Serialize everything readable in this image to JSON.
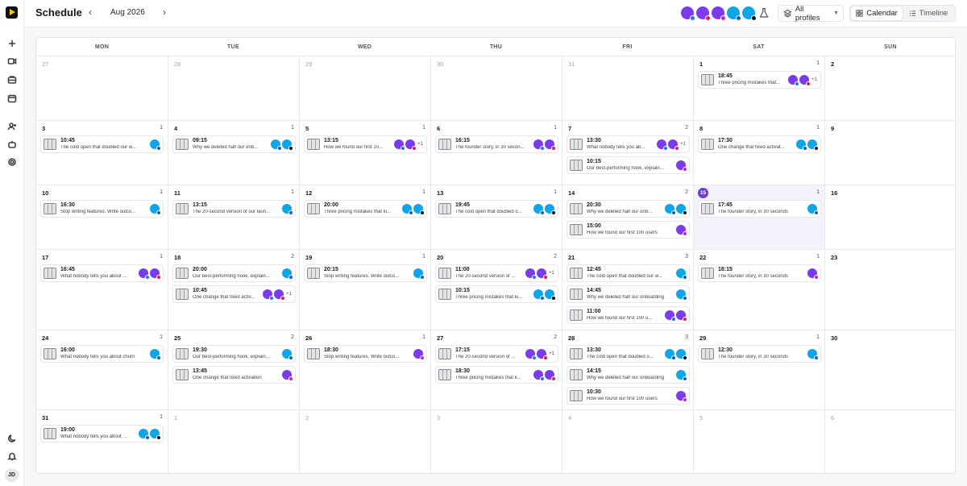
{
  "app": {
    "title": "Schedule",
    "month": "Aug 2026",
    "prev_icon": "‹",
    "next_icon": "›",
    "user_initials": "JD"
  },
  "toolbar": {
    "profiles_label": "All profiles",
    "calendar_label": "Calendar",
    "timeline_label": "Timeline"
  },
  "weekdays": [
    "MON",
    "TUE",
    "WED",
    "THU",
    "FRI",
    "SAT",
    "SUN"
  ],
  "colors": {
    "accent": "#6d3fd1",
    "purple": "#7c3aed",
    "teal": "#0ea5e9"
  },
  "rail_icons": [
    "plus-icon",
    "video-icon",
    "inbox-icon",
    "calendar-icon",
    "add-user-icon",
    "bot-icon",
    "settings-icon",
    "moon-icon",
    "bell-icon"
  ],
  "profile_avatars": [
    {
      "color": "p",
      "badge": "fb"
    },
    {
      "color": "p",
      "badge": "yt"
    },
    {
      "color": "p",
      "badge": "ig"
    },
    {
      "color": "t",
      "badge": "li"
    },
    {
      "color": "t",
      "badge": "x"
    }
  ],
  "weeks": [
    [
      {
        "day": "27",
        "out": true,
        "posts": []
      },
      {
        "day": "28",
        "out": true,
        "posts": []
      },
      {
        "day": "29",
        "out": true,
        "posts": []
      },
      {
        "day": "30",
        "out": true,
        "posts": []
      },
      {
        "day": "31",
        "out": true,
        "posts": []
      },
      {
        "day": "1",
        "count": "1",
        "posts": [
          {
            "time": "18:45",
            "text": "Three pricing mistakes that...",
            "avatars": [
              [
                "p",
                "fb"
              ],
              [
                "p",
                "yt"
              ]
            ],
            "more": "+1"
          }
        ]
      },
      {
        "day": "2",
        "posts": []
      }
    ],
    [
      {
        "day": "3",
        "count": "1",
        "posts": [
          {
            "time": "10:45",
            "text": "The cold open that doubled our w...",
            "avatars": [
              [
                "t",
                "li"
              ]
            ]
          }
        ]
      },
      {
        "day": "4",
        "count": "1",
        "posts": [
          {
            "time": "09:15",
            "text": "Why we deleted half our onb...",
            "avatars": [
              [
                "t",
                "li"
              ],
              [
                "t",
                "x"
              ]
            ]
          }
        ]
      },
      {
        "day": "5",
        "count": "1",
        "posts": [
          {
            "time": "13:15",
            "text": "How we found our first 10...",
            "avatars": [
              [
                "p",
                "fb"
              ],
              [
                "p",
                "yt"
              ]
            ],
            "more": "+1"
          }
        ]
      },
      {
        "day": "6",
        "count": "1",
        "posts": [
          {
            "time": "16:15",
            "text": "The founder story, in 30 secon...",
            "avatars": [
              [
                "p",
                "fb"
              ],
              [
                "p",
                "yt"
              ]
            ]
          }
        ]
      },
      {
        "day": "7",
        "count": "2",
        "posts": [
          {
            "time": "13:30",
            "text": "What nobody tells you ab...",
            "avatars": [
              [
                "p",
                "fb"
              ],
              [
                "p",
                "yt"
              ]
            ],
            "more": "+1"
          },
          {
            "time": "10:15",
            "text": "Our best-performing hook, explain...",
            "avatars": [
              [
                "p",
                "ig"
              ]
            ]
          }
        ]
      },
      {
        "day": "8",
        "count": "1",
        "posts": [
          {
            "time": "17:30",
            "text": "One change that fixed activat...",
            "avatars": [
              [
                "t",
                "li"
              ],
              [
                "t",
                "x"
              ]
            ]
          }
        ]
      },
      {
        "day": "9",
        "posts": []
      }
    ],
    [
      {
        "day": "10",
        "count": "1",
        "posts": [
          {
            "time": "16:30",
            "text": "Stop writing features. Write outco...",
            "avatars": [
              [
                "t",
                "li"
              ]
            ]
          }
        ]
      },
      {
        "day": "11",
        "count": "1",
        "posts": [
          {
            "time": "13:15",
            "text": "The 20-second version of our laun...",
            "avatars": [
              [
                "t",
                "li"
              ]
            ]
          }
        ]
      },
      {
        "day": "12",
        "count": "1",
        "posts": [
          {
            "time": "20:00",
            "text": "Three pricing mistakes that ki...",
            "avatars": [
              [
                "t",
                "li"
              ],
              [
                "t",
                "x"
              ]
            ]
          }
        ]
      },
      {
        "day": "13",
        "count": "1",
        "posts": [
          {
            "time": "19:45",
            "text": "The cold open that doubled o...",
            "avatars": [
              [
                "t",
                "li"
              ],
              [
                "t",
                "x"
              ]
            ]
          }
        ]
      },
      {
        "day": "14",
        "count": "2",
        "posts": [
          {
            "time": "20:30",
            "text": "Why we deleted half our onb...",
            "avatars": [
              [
                "t",
                "li"
              ],
              [
                "t",
                "x"
              ]
            ]
          },
          {
            "time": "15:00",
            "text": "How we found our first 100 users",
            "avatars": [
              [
                "p",
                "ig"
              ]
            ]
          }
        ]
      },
      {
        "day": "15",
        "today": true,
        "count": "1",
        "posts": [
          {
            "time": "17:45",
            "text": "The founder story, in 30 seconds",
            "avatars": [
              [
                "t",
                "li"
              ]
            ]
          }
        ]
      },
      {
        "day": "16",
        "posts": []
      }
    ],
    [
      {
        "day": "17",
        "count": "1",
        "posts": [
          {
            "time": "16:45",
            "text": "What nobody tells you about ...",
            "avatars": [
              [
                "p",
                "fb"
              ],
              [
                "p",
                "yt"
              ]
            ]
          }
        ]
      },
      {
        "day": "18",
        "count": "2",
        "posts": [
          {
            "time": "20:00",
            "text": "Our best-performing hook, explain...",
            "avatars": [
              [
                "t",
                "li"
              ]
            ]
          },
          {
            "time": "10:45",
            "text": "One change that fixed activ...",
            "avatars": [
              [
                "p",
                "fb"
              ],
              [
                "p",
                "yt"
              ]
            ],
            "more": "+1"
          }
        ]
      },
      {
        "day": "19",
        "count": "1",
        "posts": [
          {
            "time": "20:15",
            "text": "Stop writing features. Write outco...",
            "avatars": [
              [
                "t",
                "li"
              ]
            ]
          }
        ]
      },
      {
        "day": "20",
        "count": "2",
        "posts": [
          {
            "time": "11:00",
            "text": "The 20-second version of ...",
            "avatars": [
              [
                "p",
                "fb"
              ],
              [
                "p",
                "yt"
              ]
            ],
            "more": "+1"
          },
          {
            "time": "10:15",
            "text": "Three pricing mistakes that ki...",
            "avatars": [
              [
                "t",
                "li"
              ],
              [
                "t",
                "x"
              ]
            ]
          }
        ]
      },
      {
        "day": "21",
        "count": "3",
        "posts": [
          {
            "time": "12:45",
            "text": "The cold open that doubled our w...",
            "avatars": [
              [
                "t",
                "li"
              ]
            ]
          },
          {
            "time": "14:45",
            "text": "Why we deleted half our onboarding",
            "avatars": [
              [
                "t",
                "li"
              ]
            ]
          },
          {
            "time": "11:00",
            "text": "How we found our first 100 u...",
            "avatars": [
              [
                "p",
                "fb"
              ],
              [
                "p",
                "yt"
              ]
            ]
          }
        ]
      },
      {
        "day": "22",
        "count": "1",
        "posts": [
          {
            "time": "18:15",
            "text": "The founder story, in 30 seconds",
            "avatars": [
              [
                "p",
                "ig"
              ]
            ]
          }
        ]
      },
      {
        "day": "23",
        "posts": []
      }
    ],
    [
      {
        "day": "24",
        "count": "1",
        "posts": [
          {
            "time": "16:00",
            "text": "What nobody tells you about churn",
            "avatars": [
              [
                "t",
                "li"
              ]
            ]
          }
        ]
      },
      {
        "day": "25",
        "count": "2",
        "posts": [
          {
            "time": "19:30",
            "text": "Our best-performing hook, explain...",
            "avatars": [
              [
                "t",
                "li"
              ]
            ]
          },
          {
            "time": "13:45",
            "text": "One change that fixed activation",
            "avatars": [
              [
                "p",
                "ig"
              ]
            ]
          }
        ]
      },
      {
        "day": "26",
        "count": "1",
        "posts": [
          {
            "time": "18:30",
            "text": "Stop writing features. Write outco...",
            "avatars": [
              [
                "p",
                "ig"
              ]
            ]
          }
        ]
      },
      {
        "day": "27",
        "count": "2",
        "posts": [
          {
            "time": "17:15",
            "text": "The 20-second version of ...",
            "avatars": [
              [
                "p",
                "fb"
              ],
              [
                "p",
                "yt"
              ]
            ],
            "more": "+1"
          },
          {
            "time": "18:30",
            "text": "Three pricing mistakes that k...",
            "avatars": [
              [
                "p",
                "fb"
              ],
              [
                "p",
                "yt"
              ]
            ]
          }
        ]
      },
      {
        "day": "28",
        "count": "3",
        "posts": [
          {
            "time": "13:30",
            "text": "The cold open that doubled o...",
            "avatars": [
              [
                "t",
                "li"
              ],
              [
                "t",
                "x"
              ]
            ]
          },
          {
            "time": "14:15",
            "text": "Why we deleted half our onboarding",
            "avatars": [
              [
                "t",
                "li"
              ]
            ]
          },
          {
            "time": "10:30",
            "text": "How we found our first 100 users",
            "avatars": [
              [
                "p",
                "ig"
              ]
            ]
          }
        ]
      },
      {
        "day": "29",
        "count": "1",
        "posts": [
          {
            "time": "12:30",
            "text": "The founder story, in 30 seconds",
            "avatars": [
              [
                "t",
                "li"
              ]
            ]
          }
        ]
      },
      {
        "day": "30",
        "posts": []
      }
    ],
    [
      {
        "day": "31",
        "count": "1",
        "posts": [
          {
            "time": "19:00",
            "text": "What nobody tells you about ...",
            "avatars": [
              [
                "t",
                "li"
              ],
              [
                "t",
                "x"
              ]
            ]
          }
        ]
      },
      {
        "day": "1",
        "out": true,
        "posts": []
      },
      {
        "day": "2",
        "out": true,
        "posts": []
      },
      {
        "day": "3",
        "out": true,
        "posts": []
      },
      {
        "day": "4",
        "out": true,
        "posts": []
      },
      {
        "day": "5",
        "out": true,
        "posts": []
      },
      {
        "day": "6",
        "out": true,
        "posts": []
      }
    ]
  ]
}
